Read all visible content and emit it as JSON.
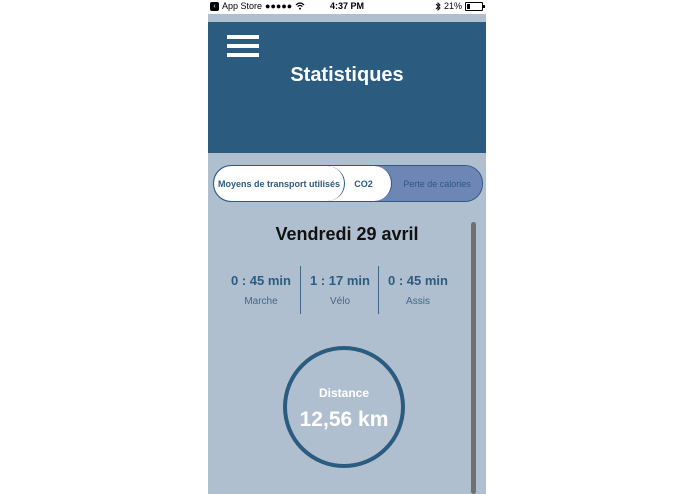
{
  "status_bar": {
    "back_app": "App Store",
    "signal": "●●●●●",
    "wifi": "wifi",
    "time": "4:37 PM",
    "bluetooth": "bluetooth",
    "battery_percent": "21%",
    "battery_level": 0.21
  },
  "header": {
    "title": "Statistiques",
    "menu_icon": "hamburger-menu"
  },
  "tabs": [
    {
      "label": "Moyens de transport utilisés",
      "selected": true
    },
    {
      "label": "CO2",
      "selected": false
    },
    {
      "label": "Perte de calories",
      "selected": false
    }
  ],
  "date": "Vendredi 29 avril",
  "stats": [
    {
      "value": "0 : 45 min",
      "label": "Marche"
    },
    {
      "value": "1 : 17 min",
      "label": "Vélo"
    },
    {
      "value": "0 : 45 min",
      "label": "Assis"
    }
  ],
  "distance": {
    "label": "Distance",
    "value": "12,56 km"
  },
  "colors": {
    "primary": "#2c5b80",
    "background": "#b0bfcf",
    "tab_inactive": "#6d86b5"
  }
}
